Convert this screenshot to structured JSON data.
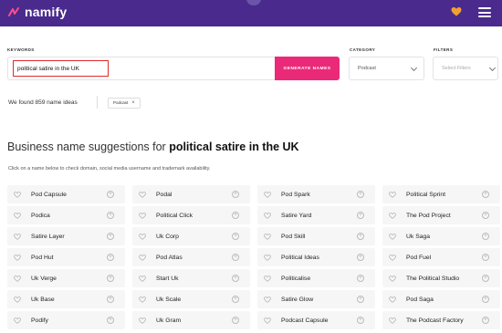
{
  "brand": {
    "name": "namify"
  },
  "search": {
    "keywords_label": "KEYWORDS",
    "keyword_value": "political satire in the UK",
    "generate_label": "GENERATE NAMES",
    "category_label": "CATEGORY",
    "category_value": "Podcast",
    "filters_label": "FILTERS",
    "filters_placeholder": "Select Filters"
  },
  "results": {
    "found_text": "We found 859 name ideas",
    "chip_label": "Podcast",
    "chip_close": "×",
    "heading_prefix": "Business name suggestions for ",
    "heading_keyword": "political satire in the UK",
    "subtext": "Click on a name below to check domain, social media username and trademark availability."
  },
  "names": [
    "Pod Capsule",
    "Podal",
    "Pod Spark",
    "Political Sprint",
    "Podica",
    "Political Click",
    "Satire Yard",
    "The Pod Project",
    "Satire Layer",
    "Uk Corp",
    "Pod Skill",
    "Uk Saga",
    "Pod Hut",
    "Pod Atlas",
    "Political Ideas",
    "Pod Fuel",
    "Uk Verge",
    "Start Uk",
    "Politicalise",
    "The Political Studio",
    "Uk Base",
    "Uk Scale",
    "Satire Glow",
    "Pod Saga",
    "Podify",
    "Uk Gram",
    "Podcast Capsule",
    "The Podcast Factory"
  ],
  "colors": {
    "topbar": "#4a2a8c",
    "accent": "#ea2a78",
    "highlight": "#e02b2b",
    "heart": "#f0a030"
  },
  "icons": {
    "logo": "namify-logo-icon",
    "heart": "heart-icon",
    "menu": "hamburger-menu-icon",
    "card_heart": "heart-outline-icon",
    "card_plus": "plus-circle-icon"
  }
}
